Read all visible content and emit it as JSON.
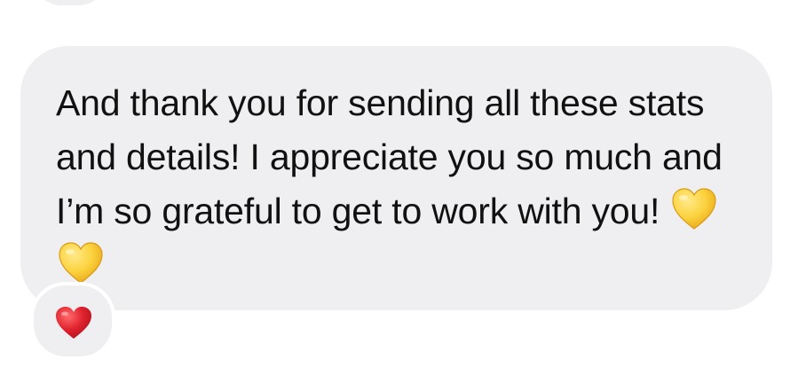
{
  "message": {
    "text": "And thank you for sending all these stats and details! I appreciate you so much and I’m so grateful to get to work with you!",
    "trailing_emoji": [
      "yellow-heart",
      "yellow-heart"
    ]
  },
  "reaction": {
    "emoji": "red-heart"
  },
  "colors": {
    "bubble_background": "#efeff2",
    "text": "#111111",
    "yellow_heart": "#fcd33f",
    "red_heart": "#e0232f",
    "page_background": "#ffffff"
  }
}
